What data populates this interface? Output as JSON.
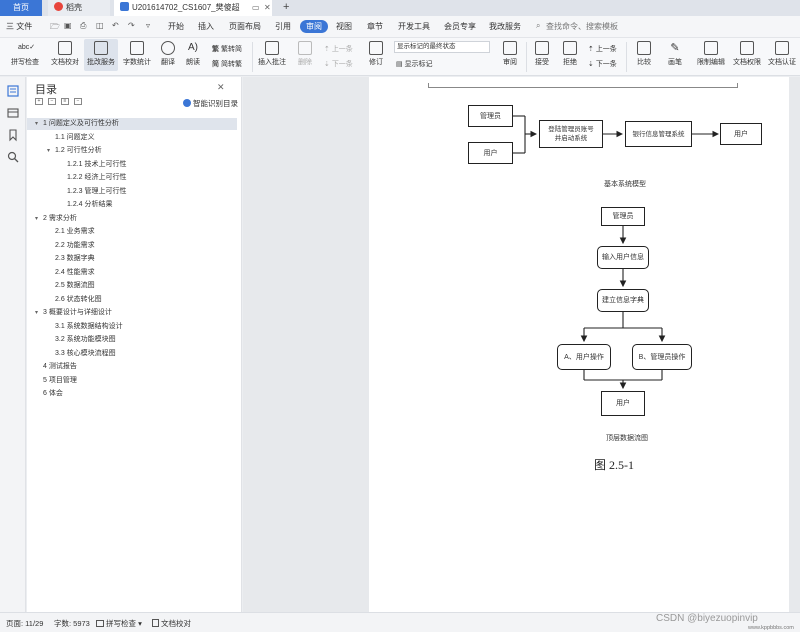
{
  "tabs": {
    "home": "首页",
    "doc1": "稻壳",
    "doc2": "U201614702_CS1607_樊傻超",
    "new_tab": "+"
  },
  "menu": {
    "file": "三 文件",
    "items": [
      "开始",
      "插入",
      "页面布局",
      "引用",
      "审阅",
      "视图",
      "章节",
      "开发工具",
      "会员专享",
      "我改服务"
    ],
    "active": "审阅",
    "search": "查找命令、搜索模板"
  },
  "ribbon": {
    "spell_check": "拼写检查",
    "doc_proof": "文档校对",
    "revise_service": "批改服务",
    "word_count": "字数统计",
    "translate": "翻译",
    "read_aloud": "朗读",
    "trad_to_simp": "繁转简",
    "simp_to_trad": "简转繁",
    "insert_comment": "插入批注",
    "delete": "删除",
    "prev": "上一条",
    "next": "下一条",
    "track": "修订",
    "track_mode": "显示标记的最终状态",
    "show_markup": "显示标记",
    "review": "审阅",
    "accept": "接受",
    "reject": "拒绝",
    "prev2": "上一条",
    "next2": "下一条",
    "compare": "比较",
    "pen": "画笔",
    "restrict_edit": "限制编辑",
    "doc_rights": "文档权限",
    "doc_cert": "文档认证"
  },
  "toc": {
    "title": "目录",
    "smart": "智能识别目录",
    "items": [
      {
        "text": "1 问题定义及可行性分析",
        "level": 1,
        "caret": "▾",
        "selected": true
      },
      {
        "text": "1.1 问题定义",
        "level": 2,
        "caret": "",
        "selected": false
      },
      {
        "text": "1.2 可行性分析",
        "level": 2,
        "caret": "▾",
        "selected": false
      },
      {
        "text": "1.2.1 技术上可行性",
        "level": 3,
        "caret": "",
        "selected": false
      },
      {
        "text": "1.2.2 经济上可行性",
        "level": 3,
        "caret": "",
        "selected": false
      },
      {
        "text": "1.2.3 管理上可行性",
        "level": 3,
        "caret": "",
        "selected": false
      },
      {
        "text": "1.2.4 分析结果",
        "level": 3,
        "caret": "",
        "selected": false
      },
      {
        "text": "2 需求分析",
        "level": 1,
        "caret": "▾",
        "selected": false
      },
      {
        "text": "2.1 业务需求",
        "level": 2,
        "caret": "",
        "selected": false
      },
      {
        "text": "2.2 功能需求",
        "level": 2,
        "caret": "",
        "selected": false
      },
      {
        "text": "2.3 数据字典",
        "level": 2,
        "caret": "",
        "selected": false
      },
      {
        "text": "2.4 性能需求",
        "level": 2,
        "caret": "",
        "selected": false
      },
      {
        "text": "2.5 数据流图",
        "level": 2,
        "caret": "",
        "selected": false
      },
      {
        "text": "2.6 状态转化图",
        "level": 2,
        "caret": "",
        "selected": false
      },
      {
        "text": "3 概要设计与详细设计",
        "level": 1,
        "caret": "▾",
        "selected": false
      },
      {
        "text": "3.1 系统数据结构设计",
        "level": 2,
        "caret": "",
        "selected": false
      },
      {
        "text": "3.2 系统功能模块图",
        "level": 2,
        "caret": "",
        "selected": false
      },
      {
        "text": "3.3 核心模块流程图",
        "level": 2,
        "caret": "",
        "selected": false
      },
      {
        "text": "4 测试报告",
        "level": 1,
        "caret": "",
        "selected": false
      },
      {
        "text": "5 项目管理",
        "level": 1,
        "caret": "",
        "selected": false
      },
      {
        "text": "6 体会",
        "level": 1,
        "caret": "",
        "selected": false
      }
    ]
  },
  "diagram1": {
    "admin": "管理员",
    "user": "用户",
    "register": "登陆管理员账号\n并启动系统",
    "bank": "银行信息管理系统",
    "out_user": "用户",
    "caption": "基本系统模型"
  },
  "diagram2": {
    "admin": "管理员",
    "input": "输入用户信息",
    "dict": "建立信息字典",
    "a": "A、用户操作",
    "b": "B、管理员操作",
    "user": "用户",
    "caption": "顶层数据流图",
    "fig": "图 2.5-1"
  },
  "status": {
    "page": "页面: 11/29",
    "words": "字数: 5973",
    "spell": "拼写检查",
    "proof": "文档校对"
  },
  "watermark": "CSDN @biyezuopinvip",
  "watermark2": "www.kppbbbs.com",
  "colors": {
    "accent": "#3b76d6"
  }
}
